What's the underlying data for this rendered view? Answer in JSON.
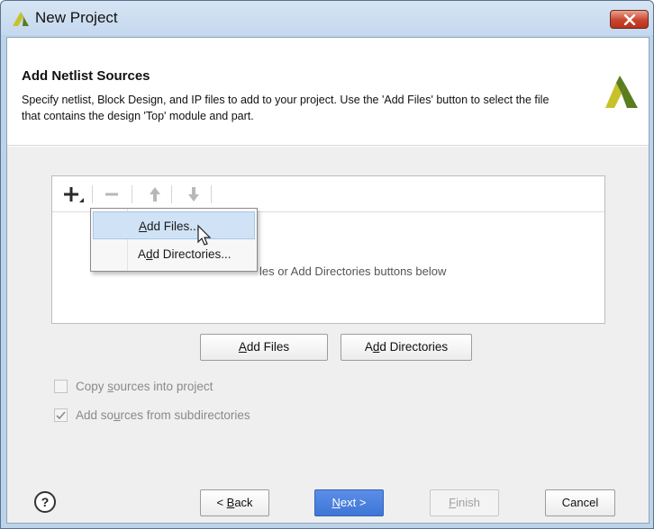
{
  "window": {
    "title": "New Project"
  },
  "header": {
    "title": "Add Netlist Sources",
    "description": "Specify netlist, Block Design, and IP files to add to your project. Use the 'Add Files' button to select the file that contains the design 'Top' module and part."
  },
  "file_list": {
    "empty_hint_partial": "les or Add Directories buttons below"
  },
  "add_menu": {
    "items": [
      {
        "label": "Add Files...",
        "hotkey": "A",
        "rest": "dd Files...",
        "highlighted": true
      },
      {
        "label": "Add Directories...",
        "hotkey": "d",
        "prefix": "A",
        "rest": "d Directories...",
        "highlighted": false
      }
    ]
  },
  "buttons": {
    "add_files": {
      "label": "Add Files",
      "hotkey": "A",
      "rest": "dd Files"
    },
    "add_directories": {
      "label": "Add Directories",
      "prefix": "A",
      "hotkey": "d",
      "rest": "d Directories"
    },
    "back": {
      "prefix": "< ",
      "hotkey": "B",
      "rest": "ack"
    },
    "next": {
      "hotkey": "N",
      "rest": "ext >"
    },
    "finish": {
      "hotkey": "F",
      "rest": "inish"
    },
    "cancel": {
      "label": "Cancel"
    },
    "help": {
      "label": "?"
    }
  },
  "options": {
    "copy_sources": {
      "prefix": "Copy ",
      "hotkey": "s",
      "rest": "ources into project",
      "checked": false,
      "enabled": false
    },
    "add_subdirs": {
      "prefix": "Add so",
      "hotkey": "u",
      "rest": "rces from subdirectories",
      "checked": true,
      "enabled": false
    }
  },
  "colors": {
    "accent": "#3f76d6",
    "logo_yellow": "#c8c22a",
    "logo_green": "#5a7d1e",
    "close_red": "#c8462e"
  },
  "icons": {
    "title_logo": "vivado-logo-icon",
    "header_logo": "vivado-logo-icon",
    "close": "close-icon",
    "add": "plus-icon",
    "remove": "minus-icon",
    "up": "arrow-up-icon",
    "down": "arrow-down-icon",
    "cursor": "mouse-pointer-icon"
  }
}
